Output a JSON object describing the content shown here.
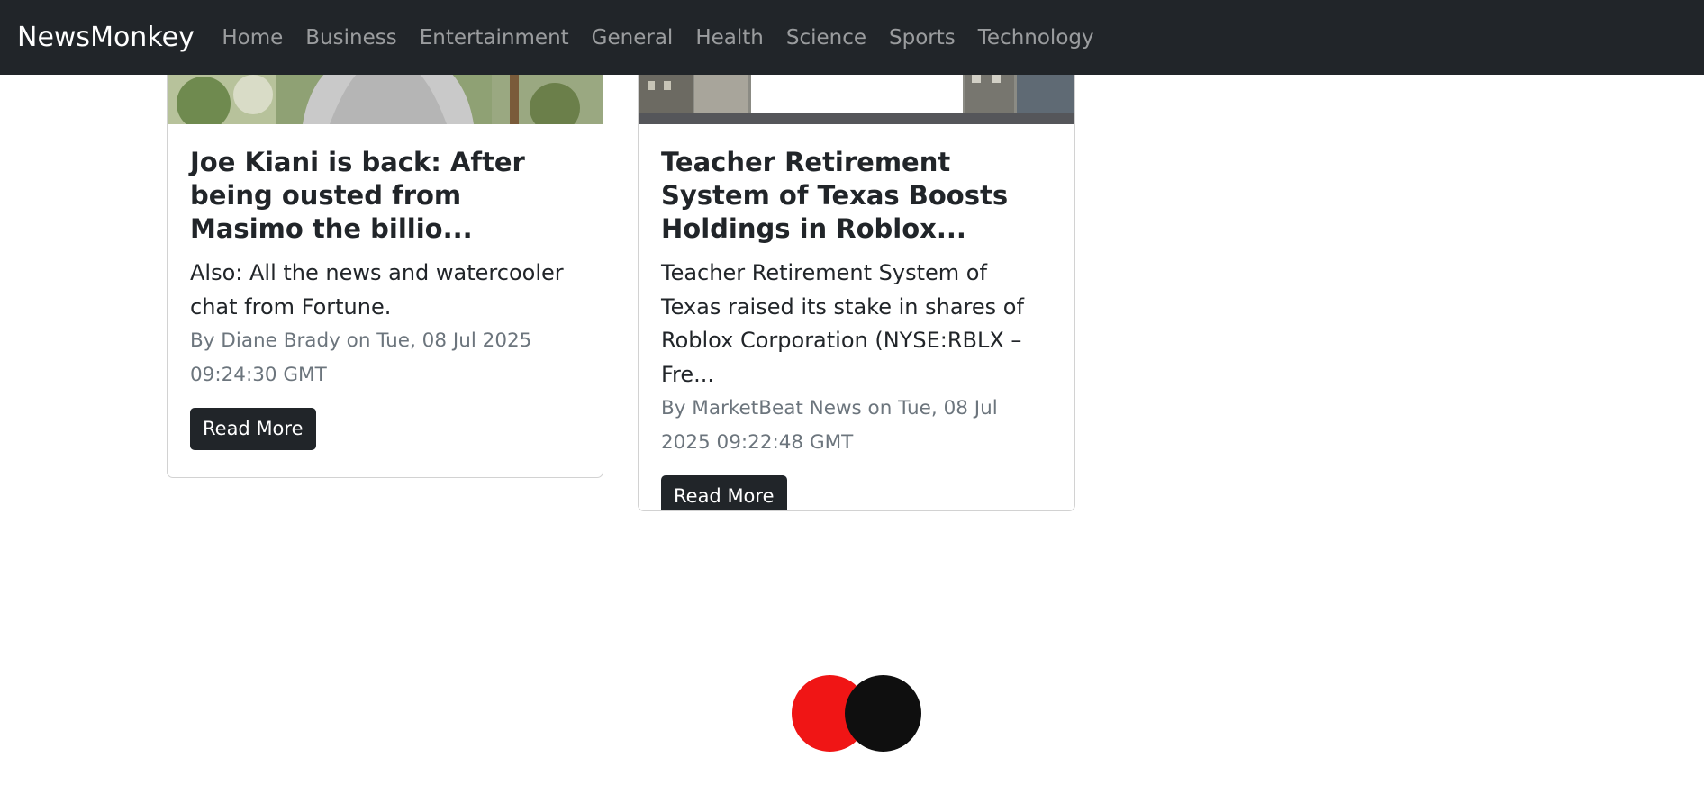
{
  "navbar": {
    "brand": "NewsMonkey",
    "links": [
      "Home",
      "Business",
      "Entertainment",
      "General",
      "Health",
      "Science",
      "Sports",
      "Technology"
    ]
  },
  "articles": [
    {
      "title": "Joe Kiani is back: After being ousted from Masimo the billio...",
      "description": "Also: All the news and watercooler chat from Fortune.",
      "byline": "By Diane Brady on Tue, 08 Jul 2025 09:24:30 GMT",
      "button": "Read More"
    },
    {
      "title": "Teacher Retirement System of Texas Boosts Holdings in Roblox...",
      "description": "Teacher Retirement System of Texas raised its stake in shares of Roblox Corporation (NYSE:RBLX – Fre...",
      "byline": "By MarketBeat News on Tue, 08 Jul 2025 09:22:48 GMT",
      "button": "Read More"
    }
  ],
  "loader": {
    "colors": [
      "#f01515",
      "#0f0f0f"
    ]
  }
}
